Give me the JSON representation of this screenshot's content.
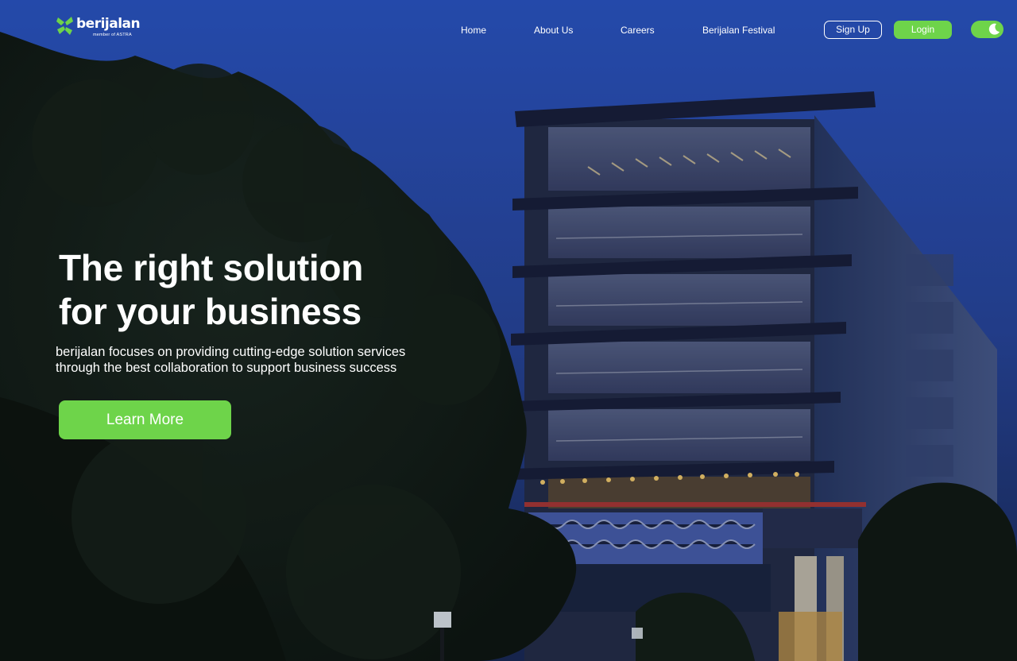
{
  "nav": {
    "logo": {
      "brand": "berijalan",
      "tagline": "member of ASTRA"
    },
    "links": [
      {
        "label": "Home"
      },
      {
        "label": "About Us"
      },
      {
        "label": "Careers"
      },
      {
        "label": "Berijalan Festival"
      }
    ],
    "signup_label": "Sign Up",
    "login_label": "Login",
    "theme_toggle_icon": "moon-icon"
  },
  "hero": {
    "headline_line1": "The right solution",
    "headline_line2": "for your business",
    "subtitle_line1": "berijalan focuses on providing cutting-edge solution services",
    "subtitle_line2": "through the best collaboration to support business success",
    "cta_label": "Learn More"
  },
  "colors": {
    "accent_green": "#6ed44a",
    "sky_blue": "#2c58c9",
    "text": "#ffffff"
  }
}
